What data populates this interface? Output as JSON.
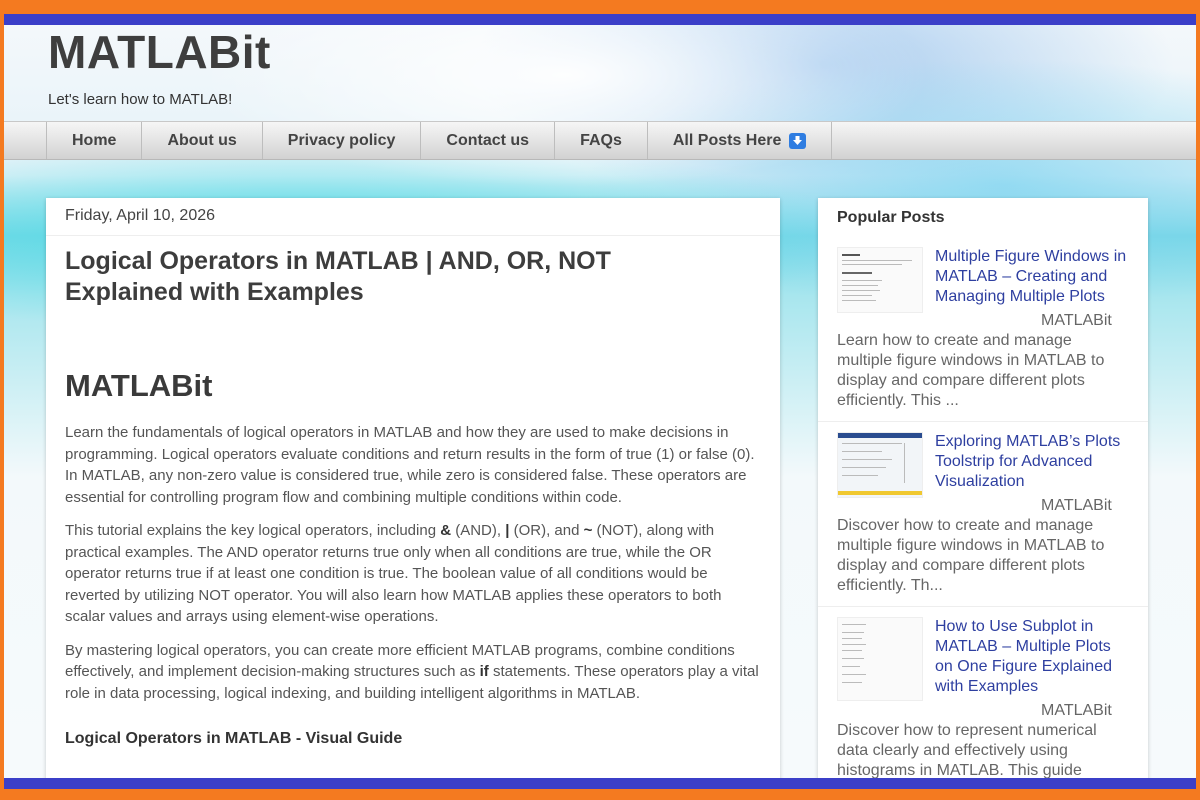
{
  "site": {
    "title": "MATLABit",
    "tagline": "Let's learn how to MATLAB!"
  },
  "nav": {
    "items": [
      "Home",
      "About us",
      "Privacy policy",
      "Contact us",
      "FAQs",
      "All Posts Here"
    ]
  },
  "post": {
    "date": "Friday, April 10, 2026",
    "title": "Logical Operators in MATLAB | AND, OR, NOT Explained with Examples",
    "heading": "MATLABit",
    "p1": "Learn the fundamentals of logical operators in MATLAB and how they are used to make decisions in programming. Logical operators evaluate conditions and return results in the form of true (1) or false (0). In MATLAB, any non-zero value is considered true, while zero is considered false. These operators are essential for controlling program flow and combining multiple conditions within code.",
    "p2_a": "This tutorial explains the key logical operators, including ",
    "p2_and": "&",
    "p2_b": " (AND), ",
    "p2_or": "|",
    "p2_c": " (OR), and ",
    "p2_not": "~",
    "p2_d": " (NOT), along with practical examples. The AND operator returns true only when all conditions are true, while the OR operator returns true if at least one condition is true. The boolean value of all conditions would be reverted by utilizing NOT operator. You will also learn how MATLAB applies these operators to both scalar values and arrays using element-wise operations.",
    "p3_a": "By mastering logical operators, you can create more efficient MATLAB programs, combine conditions effectively, and implement decision-making structures such as ",
    "p3_if": "if",
    "p3_b": " statements. These operators play a vital role in data processing, logical indexing, and building intelligent algorithms in MATLAB.",
    "subheading": "Logical Operators in MATLAB - Visual Guide"
  },
  "sidebar": {
    "title": "Popular Posts",
    "posts": [
      {
        "title": "Multiple Figure Windows in MATLAB – Creating and Managing Multiple Plots",
        "snippet": "MATLABit Learn how to create and manage multiple figure windows in MATLAB to display and compare different plots efficiently. This ..."
      },
      {
        "title": "Exploring MATLAB’s Plots Toolstrip for Advanced Visualization",
        "snippet": "MATLABit Discover how to create and manage multiple figure windows in MATLAB to display and compare different plots efficiently. Th..."
      },
      {
        "title": "How to Use Subplot in MATLAB – Multiple Plots on One Figure Explained with Examples",
        "snippet": "MATLABit Discover how to represent numerical data clearly and effectively using histograms in MATLAB. This guide explains how ..."
      }
    ]
  },
  "colors": {
    "border_orange": "#f47a20",
    "border_blue": "#3b3fc8",
    "link": "#2e3fa0",
    "nav_icon": "#2f7de1"
  }
}
